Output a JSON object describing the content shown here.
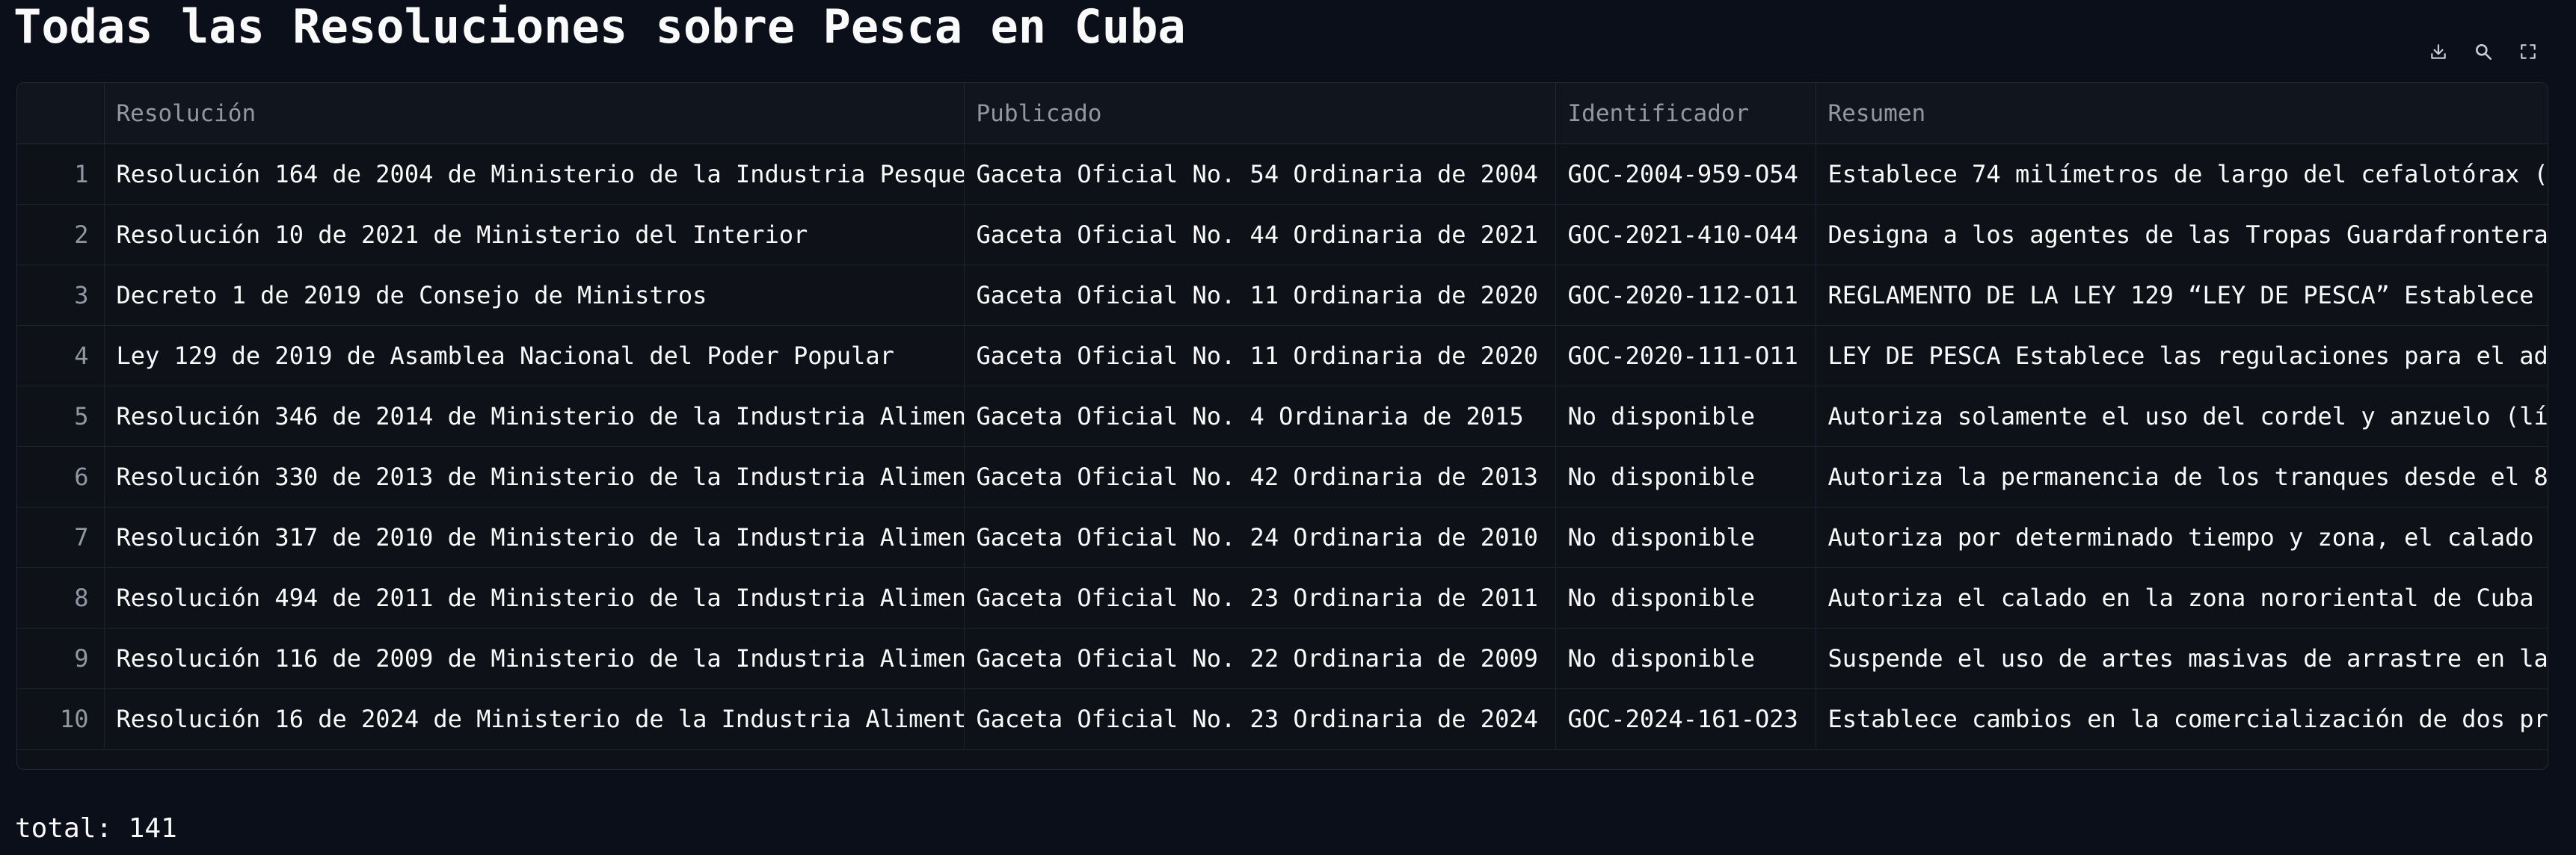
{
  "title": "Todas las Resoluciones sobre Pesca en Cuba",
  "toolbar": {
    "icons": [
      "download-icon",
      "search-icon",
      "fullscreen-icon"
    ]
  },
  "table": {
    "columns": [
      "",
      "Resolución",
      "Publicado",
      "Identificador",
      "Resumen"
    ],
    "rows": [
      {
        "idx": "1",
        "resolucion": "Resolución 164 de 2004 de Ministerio de la Industria Pesquera",
        "publicado": "Gaceta Oficial No. 54 Ordinaria de 2004",
        "identificador": "GOC-2004-959-O54",
        "resumen": "Establece 74 milímetros de largo del cefalotórax ("
      },
      {
        "idx": "2",
        "resolucion": "Resolución 10 de 2021 de Ministerio del Interior",
        "publicado": "Gaceta Oficial No. 44 Ordinaria de 2021",
        "identificador": "GOC-2021-410-O44",
        "resumen": "Designa a los agentes de las Tropas Guardafronteras"
      },
      {
        "idx": "3",
        "resolucion": "Decreto 1 de 2019 de Consejo de Ministros",
        "publicado": "Gaceta Oficial No. 11 Ordinaria de 2020",
        "identificador": "GOC-2020-112-O11",
        "resumen": "REGLAMENTO DE LA LEY 129 “LEY DE PESCA” Establece"
      },
      {
        "idx": "4",
        "resolucion": "Ley 129 de 2019 de Asamblea Nacional del Poder Popular",
        "publicado": "Gaceta Oficial No. 11 Ordinaria de 2020",
        "identificador": "GOC-2020-111-O11",
        "resumen": "LEY DE PESCA Establece las regulaciones para el ad"
      },
      {
        "idx": "5",
        "resolucion": "Resolución 346 de 2014 de Ministerio de la Industria Alimentaria",
        "publicado": "Gaceta Oficial No. 4 Ordinaria de 2015",
        "identificador": "No disponible",
        "resumen": "Autoriza solamente el uso del cordel y anzuelo (lí"
      },
      {
        "idx": "6",
        "resolucion": "Resolución 330 de 2013 de Ministerio de la Industria Alimentaria",
        "publicado": "Gaceta Oficial No. 42 Ordinaria de 2013",
        "identificador": "No disponible",
        "resumen": "Autoriza la permanencia de los tranques desde el 8"
      },
      {
        "idx": "7",
        "resolucion": "Resolución 317 de 2010 de Ministerio de la Industria Alimentaria",
        "publicado": "Gaceta Oficial No. 24 Ordinaria de 2010",
        "identificador": "No disponible",
        "resumen": "Autoriza por determinado tiempo y zona, el calado"
      },
      {
        "idx": "8",
        "resolucion": "Resolución 494 de 2011 de Ministerio de la Industria Alimentaria",
        "publicado": "Gaceta Oficial No. 23 Ordinaria de 2011",
        "identificador": "No disponible",
        "resumen": "Autoriza el calado en la zona nororiental de Cuba"
      },
      {
        "idx": "9",
        "resolucion": "Resolución 116 de 2009 de Ministerio de la Industria Alimentaria",
        "publicado": "Gaceta Oficial No. 22 Ordinaria de 2009",
        "identificador": "No disponible",
        "resumen": "Suspende el uso de artes masivas de arrastre en la"
      },
      {
        "idx": "10",
        "resolucion": "Resolución 16 de 2024 de Ministerio de la Industria Alimentaria",
        "publicado": "Gaceta Oficial No. 23 Ordinaria de 2024",
        "identificador": "GOC-2024-161-O23",
        "resumen": "Establece cambios en la comercialización de dos pr"
      }
    ]
  },
  "footer": {
    "total_label": "total: 141"
  }
}
